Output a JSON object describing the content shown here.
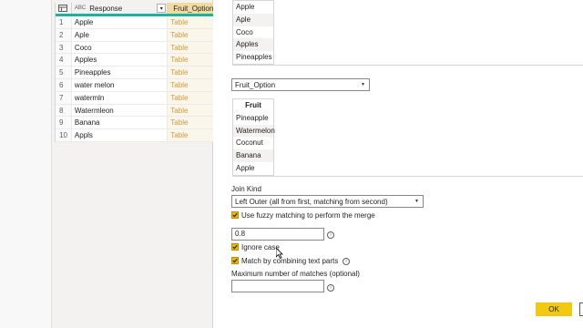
{
  "grid": {
    "columns": [
      {
        "name": "Response",
        "type_icon": "ABC"
      },
      {
        "name": "Fruit_Option",
        "type_icon": "table-icon"
      }
    ],
    "rows": [
      {
        "index": "1",
        "response": "Apple",
        "value": "Table"
      },
      {
        "index": "2",
        "response": "Aple",
        "value": "Table"
      },
      {
        "index": "3",
        "response": "Coco",
        "value": "Table"
      },
      {
        "index": "4",
        "response": "Apples",
        "value": "Table"
      },
      {
        "index": "5",
        "response": "Pineapples",
        "value": "Table"
      },
      {
        "index": "6",
        "response": "water melon",
        "value": "Table"
      },
      {
        "index": "7",
        "response": "watermln",
        "value": "Table"
      },
      {
        "index": "8",
        "response": "Watermleon",
        "value": "Table"
      },
      {
        "index": "9",
        "response": "Banana",
        "value": "Table"
      },
      {
        "index": "10",
        "response": "Appls",
        "value": "Table"
      }
    ]
  },
  "first_preview": {
    "rows": [
      "Apple",
      "Aple",
      "Coco",
      "Apples",
      "Pineapples"
    ]
  },
  "second_table_select": {
    "value": "Fruit_Option"
  },
  "second_preview": {
    "header": "Fruit",
    "rows": [
      "Pineapple",
      "Watermelon",
      "Coconut",
      "Banana",
      "Apple"
    ]
  },
  "join_kind": {
    "label": "Join Kind",
    "value": "Left Outer (all from first, matching from second)"
  },
  "fuzzy": {
    "use_fuzzy_label": "Use fuzzy matching to perform the merge",
    "threshold_value": "0.8",
    "ignore_case_label": "Ignore case",
    "combine_parts_label": "Match by combining text parts",
    "max_matches_label": "Maximum number of matches (optional)",
    "max_matches_value": ""
  },
  "buttons": {
    "ok": "OK"
  },
  "colors": {
    "accent": "#f2c811",
    "column_highlight": "#1ab39f",
    "table_link": "#d39a3b"
  }
}
